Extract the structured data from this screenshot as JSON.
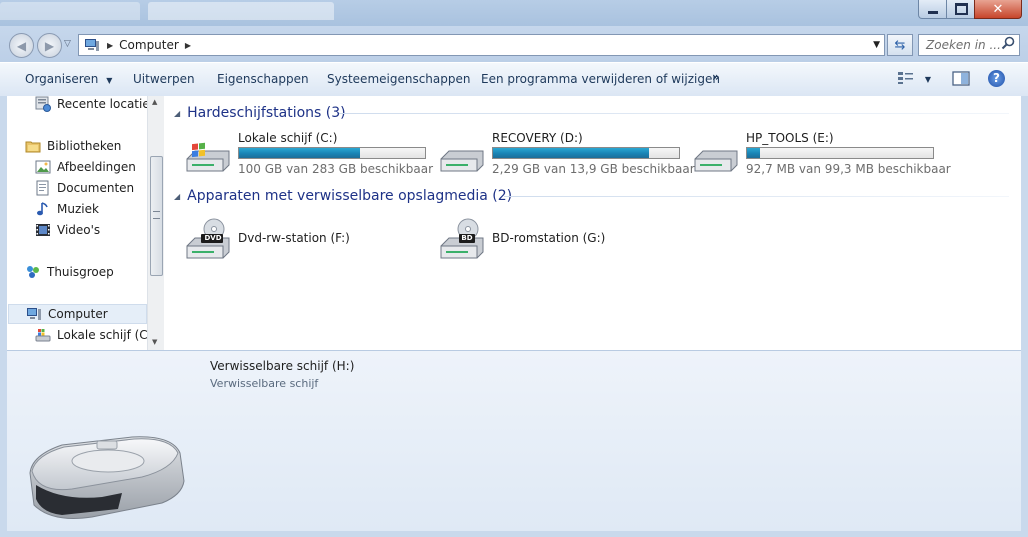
{
  "colors": {
    "accent": "#1e3287",
    "bar_fill": "#1a84b5",
    "frame": "#c9d9ec"
  },
  "address_bar": {
    "computer_icon": "computer-icon",
    "breadcrumb": "Computer"
  },
  "search": {
    "placeholder": "Zoeken in ..."
  },
  "toolbar": {
    "organize": "Organiseren",
    "eject": "Uitwerpen",
    "properties": "Eigenschappen",
    "system_properties": "Systeemeigenschappen",
    "uninstall": "Een programma verwijderen of wijzigen",
    "more": "»"
  },
  "sidebar": {
    "items": [
      {
        "label": "Recente locaties",
        "icon": "recent-places-icon"
      },
      {
        "label": "Bibliotheken",
        "icon": "libraries-icon"
      },
      {
        "label": "Afbeeldingen",
        "icon": "pictures-icon"
      },
      {
        "label": "Documenten",
        "icon": "documents-icon"
      },
      {
        "label": "Muziek",
        "icon": "music-icon"
      },
      {
        "label": "Video's",
        "icon": "videos-icon"
      },
      {
        "label": "Thuisgroep",
        "icon": "homegroup-icon"
      },
      {
        "label": "Computer",
        "icon": "computer-icon"
      },
      {
        "label": "Lokale schijf (C:)",
        "icon": "local-disk-icon"
      }
    ]
  },
  "groups": {
    "hard_drives": {
      "title": "Hardeschijfstations (3)"
    },
    "removable": {
      "title": "Apparaten met verwisselbare opslagmedia (2)"
    }
  },
  "drives": [
    {
      "name": "Lokale schijf (C:)",
      "free": "100 GB van 283 GB beschikbaar",
      "used_fraction": 0.65
    },
    {
      "name": "RECOVERY (D:)",
      "free": "2,29 GB van 13,9 GB beschikbaar",
      "used_fraction": 0.84
    },
    {
      "name": "HP_TOOLS (E:)",
      "free": "92,7 MB van 99,3 MB beschikbaar",
      "used_fraction": 0.07
    }
  ],
  "devices": [
    {
      "name": "Dvd-rw-station (F:)",
      "badge": "DVD"
    },
    {
      "name": "BD-romstation (G:)",
      "badge": "BD"
    }
  ],
  "details": {
    "title": "Verwisselbare schijf (H:)",
    "subtitle": "Verwisselbare schijf"
  }
}
